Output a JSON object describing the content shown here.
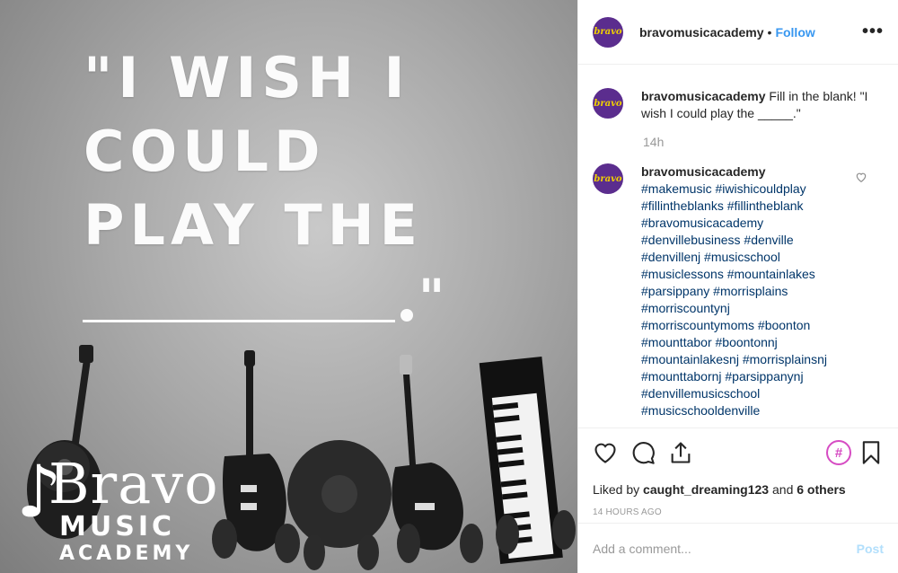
{
  "image": {
    "quote_line1": "\"I WISH I",
    "quote_line2": "COULD",
    "quote_line3": "PLAY THE",
    "quote_close": "\"",
    "logo_bravo": "Bravo",
    "logo_music": "MUSIC",
    "logo_academy": "ACADEMY"
  },
  "header": {
    "username": "bravomusicacademy",
    "separator": "•",
    "follow_label": "Follow",
    "more_label": "•••",
    "avatar_text": "bravo"
  },
  "comments": {
    "caption_user": "bravomusicacademy",
    "caption_text": "Fill in the blank! \"I wish I could play the _____.\"",
    "caption_time": "14h",
    "tags_user": "bravomusicacademy",
    "tags": [
      "#makemusic #iwishicouldplay",
      "#fillintheblanks #fillintheblank",
      "#bravomusicacademy",
      "#denvillebusiness #denville",
      "#denvillenj #musicschool",
      "#musiclessons #mountainlakes",
      "#parsippany #morrisplains",
      "#morriscountynj",
      "#morriscountymoms #boonton",
      "#mounttabor #boontonnj",
      "#mountainlakesnj #morrisplainsnj",
      "#mounttabornj #parsippanynj",
      "#denvillemusicschool",
      "#musicschooldenville"
    ]
  },
  "actions": {
    "hash_label": "#",
    "liked_by_prefix": "Liked by",
    "liked_by_user": "caught_dreaming123",
    "liked_by_and": "and",
    "liked_by_others": "6 others",
    "posted_ago": "14 HOURS AGO"
  },
  "add_comment": {
    "placeholder": "Add a comment...",
    "post_label": "Post"
  },
  "colors": {
    "accent_blue": "#3897f0",
    "hashtag": "#003569",
    "avatar_bg": "#5b2d8e",
    "hash_icon": "#d64cc3"
  }
}
